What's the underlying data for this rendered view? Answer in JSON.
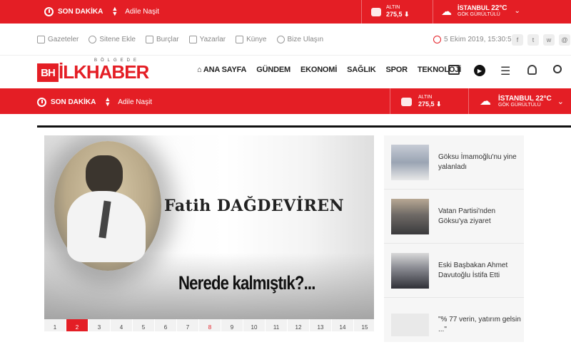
{
  "ticker": {
    "label": "SON DAKİKA",
    "headline": "Adile Naşit"
  },
  "gold": {
    "label": "ALTIN",
    "value": "275,5 ⬇"
  },
  "weather": {
    "city": "İSTANBUL",
    "temp": "22°C",
    "desc": "GÖK GÜRÜLTÜLÜ"
  },
  "utility_links": [
    "Gazeteler",
    "Sitene Ekle",
    "Burçlar",
    "Yazarlar",
    "Künye",
    "Bize Ulaşın"
  ],
  "datetime": "5 Ekim 2019, 15:30:55",
  "social": [
    "f",
    "t",
    "w",
    "@"
  ],
  "logo": {
    "top": "BÖLGEDE",
    "mark": "BH",
    "name": "İLKHABER"
  },
  "nav": [
    "ANA SAYFA",
    "GÜNDEM",
    "EKONOMİ",
    "SAĞLIK",
    "SPOR",
    "TEKNOLOJİ"
  ],
  "hero": {
    "author": "Fatih DAĞDEVİREN",
    "title": "Nerede kalmıştık?..."
  },
  "pagination": [
    "1",
    "2",
    "3",
    "4",
    "5",
    "6",
    "7",
    "8",
    "9",
    "10",
    "11",
    "12",
    "13",
    "14",
    "15"
  ],
  "side_news": [
    "Göksu İmamoğlu'nu yine yalanladı",
    "Vatan Partisi'nden Göksu'ya ziyaret",
    "Eski Başbakan Ahmet Davutoğlu İstifa Etti",
    "\"% 77 verin, yatırım gelsin ...\""
  ],
  "colors": {
    "brand": "#e41e25"
  }
}
